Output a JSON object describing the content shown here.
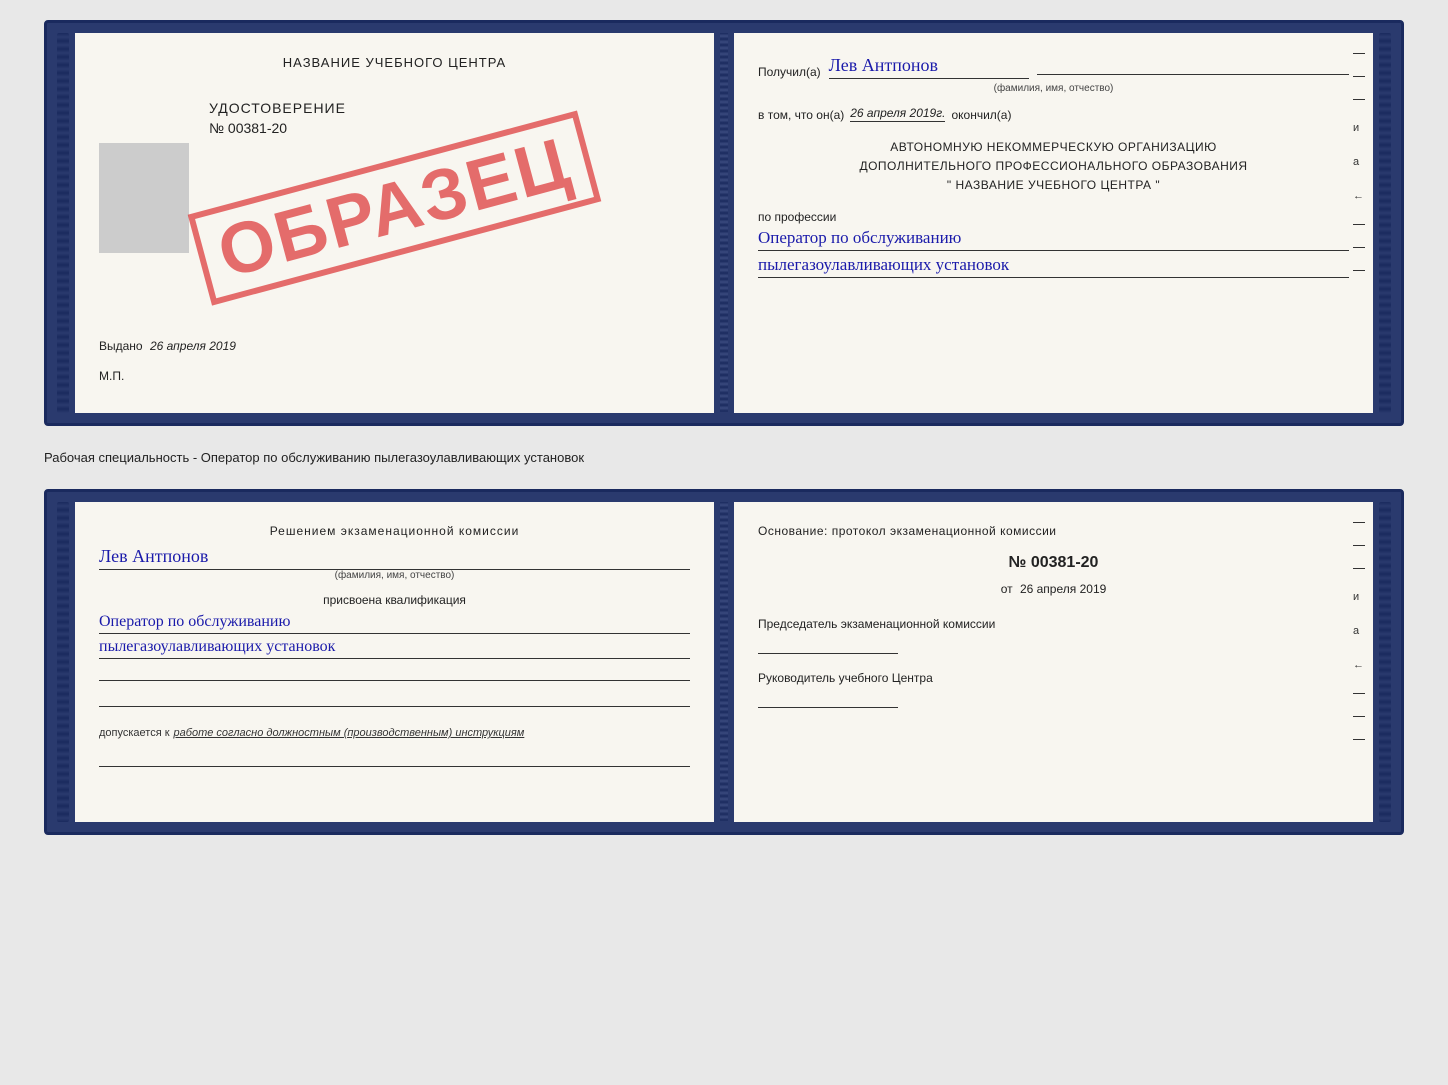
{
  "top_book": {
    "left_page": {
      "title": "НАЗВАНИЕ УЧЕБНОГО ЦЕНТРА",
      "stamp_text": "ОБРАЗЕЦ",
      "udostoverenie_label": "УДОСТОВЕРЕНИЕ",
      "number": "№ 00381-20",
      "vydano_label": "Выдано",
      "vydano_date": "26 апреля 2019",
      "mp_label": "М.П."
    },
    "right_page": {
      "poluchil_label": "Получил(а)",
      "recipient_name": "Лев Антпонов",
      "fio_label": "(фамилия, имя, отчество)",
      "vtom_label": "в том, что он(а)",
      "vtom_date": "26 апреля 2019г.",
      "okonchil_label": "окончил(а)",
      "org_line1": "АВТОНОМНУЮ НЕКОММЕРЧЕСКУЮ ОРГАНИЗАЦИЮ",
      "org_line2": "ДОПОЛНИТЕЛЬНОГО ПРОФЕССИОНАЛЬНОГО ОБРАЗОВАНИЯ",
      "org_line3": "\"   НАЗВАНИЕ УЧЕБНОГО ЦЕНТРА   \"",
      "po_professii_label": "по профессии",
      "profession_line1": "Оператор по обслуживанию",
      "profession_line2": "пылегазоулавливающих установок"
    }
  },
  "separator": {
    "text": "Рабочая специальность - Оператор по обслуживанию пылегазоулавливающих установок"
  },
  "bottom_book": {
    "left_page": {
      "resheniem_label": "Решением экзаменационной комиссии",
      "recipient_name": "Лев Антпонов",
      "fio_label": "(фамилия, имя, отчество)",
      "prisvoena_label": "присвоена квалификация",
      "profession_line1": "Оператор по обслуживанию",
      "profession_line2": "пылегазоулавливающих установок",
      "dopuskaetsya_label": "допускается к",
      "dopuskaetsya_value": "работе согласно должностным (производственным) инструкциям"
    },
    "right_page": {
      "osnovanie_label": "Основание: протокол экзаменационной комиссии",
      "protocol_number": "№  00381-20",
      "ot_label": "от",
      "ot_date": "26 апреля 2019",
      "predsedatel_label": "Председатель экзаменационной комиссии",
      "rukovoditel_label": "Руководитель учебного Центра"
    }
  },
  "side_labels": {
    "i_label": "и",
    "a_label": "а",
    "arrow_label": "←"
  }
}
